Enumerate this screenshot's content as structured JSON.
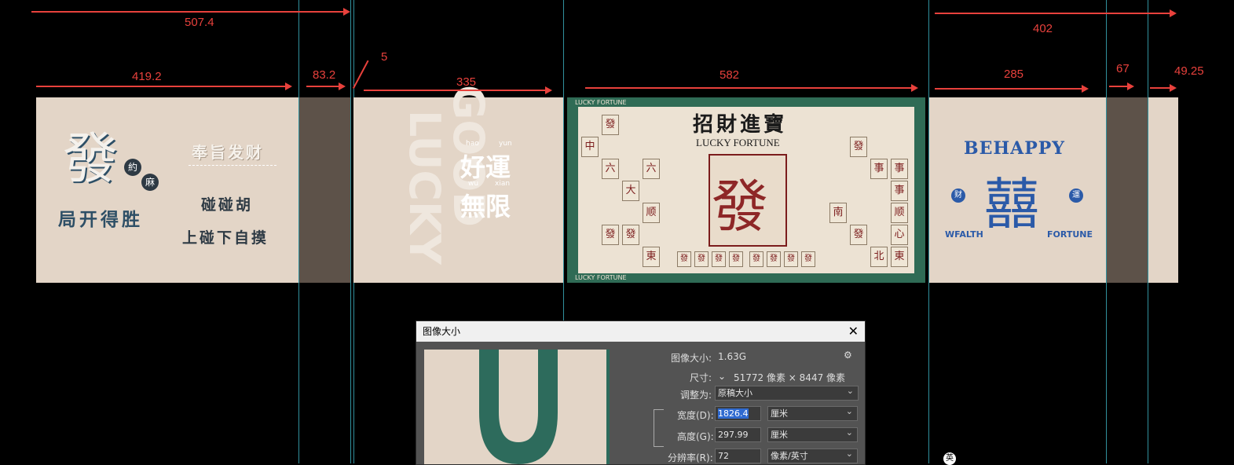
{
  "dimensions": {
    "d1": "507.4",
    "d2": "419.2",
    "d3": "83.2",
    "d4": "5",
    "d5": "335",
    "d6": "582",
    "d7": "402",
    "d8": "285",
    "d9": "67",
    "d10": "49.25"
  },
  "panel1": {
    "big_char": "發",
    "small1": "約",
    "small2": "麻",
    "line1": "局开得胜",
    "slogan": "奉旨发财",
    "line2": "碰碰胡",
    "line3": "上碰下自摸"
  },
  "panel2": {
    "vertical1": "GOOD",
    "vertical2": "LUCKY",
    "pin1a": "hao",
    "pin1b": "yun",
    "text1": "好運",
    "pin2a": "wu",
    "pin2b": "xian",
    "text2": "無限"
  },
  "panel3": {
    "border_text": "LUCKY FORTUNE",
    "title": "招財進寶",
    "subtitle": "LUCKY FORTUNE",
    "center_char": "發",
    "tiles_left": [
      "發",
      "中",
      "六",
      "六",
      "大",
      "顺",
      "發",
      "發",
      "東"
    ],
    "tiles_right": [
      "發",
      "事",
      "事",
      "事",
      "南",
      "顺",
      "發",
      "心",
      "北",
      "東"
    ],
    "bottom_tiles": [
      "發",
      "發",
      "發",
      "發",
      "發",
      "發",
      "發",
      "發"
    ]
  },
  "panel4": {
    "title": "BEHAPPY",
    "big_char": "囍",
    "left_badge": "财",
    "right_badge": "運",
    "left_word": "WFALTH",
    "right_word": "FORTUNE"
  },
  "dialog": {
    "title": "图像大小",
    "image_size_label": "图像大小:",
    "image_size_value": "1.63G",
    "dims_label": "尺寸:",
    "dims_value": "51772 像素 × 8447 像素",
    "fit_label": "调整为:",
    "fit_value": "原稿大小",
    "width_label": "宽度(D):",
    "width_value": "1826.4",
    "width_unit": "厘米",
    "height_label": "高度(G):",
    "height_value": "297.99",
    "height_unit": "厘米",
    "res_label": "分辨率(R):",
    "res_value": "72",
    "res_unit": "像素/英寸"
  },
  "ime_badge": "英",
  "colors": {
    "accent": "#e8413c",
    "guide": "#3aa9b8",
    "panel": "#e3d5c7",
    "dark": "#5d5249",
    "green": "#2f6b55",
    "blue": "#2b5aa8"
  }
}
